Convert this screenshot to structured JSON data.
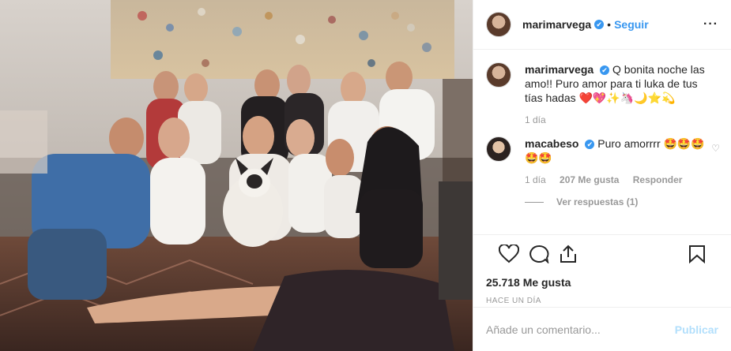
{
  "post": {
    "image_alt": "Grupo de mujeres sentadas sobre una alfombra con un perro"
  },
  "header": {
    "username": "marimarvega",
    "verified": "✔",
    "separator": "•",
    "follow_label": "Seguir",
    "more_label": "···"
  },
  "comments": [
    {
      "username": "marimarvega",
      "verified": "✔",
      "text": " Q bonita noche las amo!! Puro amor para ti luka de tus tías hadas ❤️💖✨🦄🌙⭐💫",
      "time": "1 día"
    },
    {
      "username": "macabeso",
      "verified": "✔",
      "text": " Puro amorrrr 🤩🤩🤩🤩🤩",
      "time": "1 día",
      "likes": "207 Me gusta",
      "reply_label": "Responder",
      "view_replies": "Ver respuestas (1)"
    }
  ],
  "actions": {
    "likes": "25.718 Me gusta",
    "time_ago": "HACE UN DÍA"
  },
  "add_comment": {
    "placeholder": "Añade un comentario...",
    "publish_label": "Publicar"
  },
  "colors": {
    "accent": "#3897f0",
    "publish_disabled": "#b2dffc",
    "muted": "#999999"
  }
}
